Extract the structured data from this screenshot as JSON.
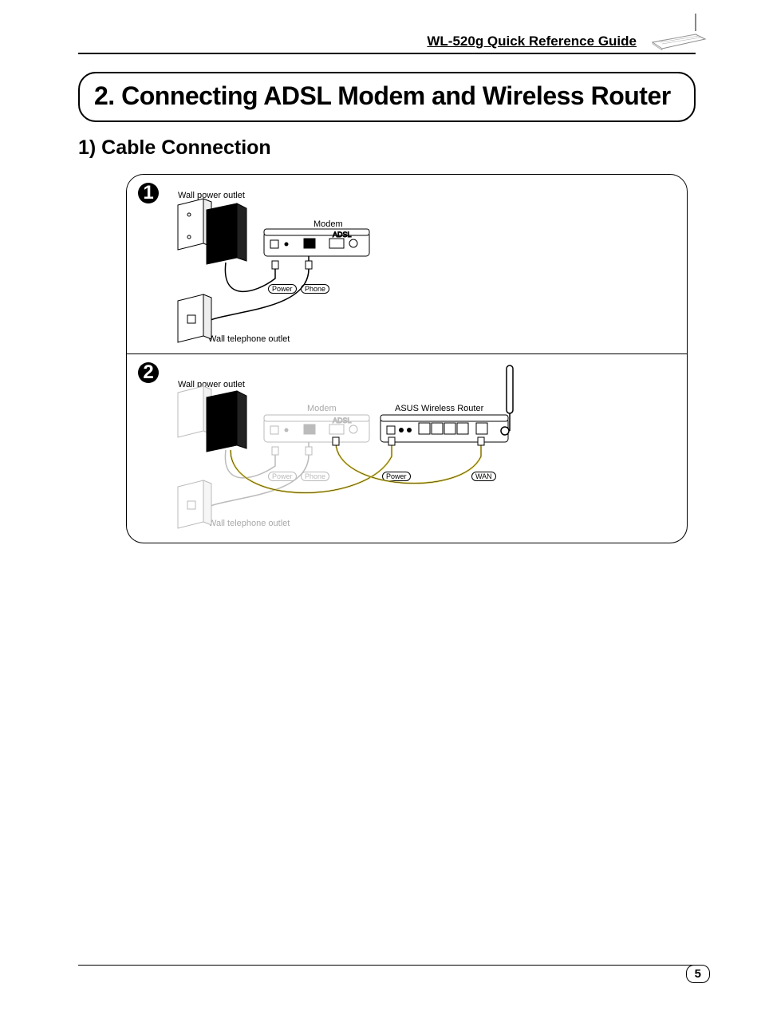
{
  "header": {
    "guide_title": "WL-520g Quick Reference Guide"
  },
  "section": {
    "title": "2. Connecting ADSL Modem and Wireless Router"
  },
  "subsection": {
    "title": "1) Cable Connection"
  },
  "panel1": {
    "step": "1",
    "labels": {
      "wall_power": "Wall power outlet",
      "modem": "Modem",
      "wall_phone": "Wall telephone outlet",
      "power": "Power",
      "phone": "Phone"
    }
  },
  "panel2": {
    "step": "2",
    "labels": {
      "wall_power": "Wall power outlet",
      "modem": "Modem",
      "asus_router": "ASUS Wireless Router",
      "wall_phone": "Wall telephone outlet",
      "power": "Power",
      "phone": "Phone",
      "power2": "Power",
      "wan": "WAN"
    }
  },
  "page_number": "5"
}
